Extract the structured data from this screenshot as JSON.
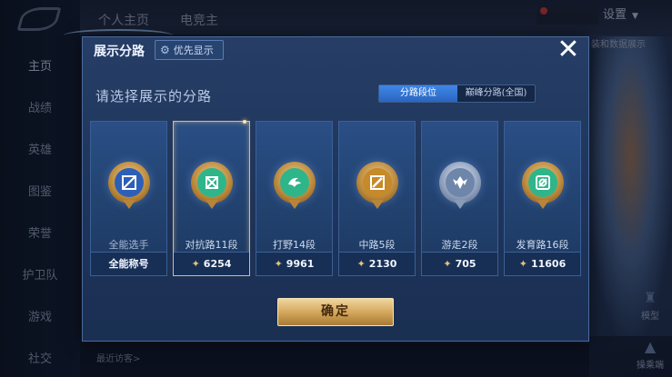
{
  "background": {
    "sidebar": [
      "主页",
      "战绩",
      "英雄",
      "图鉴",
      "荣誉",
      "护卫队",
      "游戏",
      "社交"
    ],
    "tabs": [
      "个人主页",
      "电竞主"
    ],
    "settings": "设置",
    "right_text": "装和数据展示",
    "right_buttons": [
      "模型",
      "操乘端"
    ],
    "recent": "最近访客>"
  },
  "dialog": {
    "title": "展示分路",
    "priority_label": "优先显示",
    "close_icon": "close-icon",
    "prompt": "请选择展示的分路",
    "segment": {
      "tabs": [
        "分路段位",
        "巅峰分路(全国)"
      ],
      "selected": 0
    },
    "cards": [
      {
        "label": "全能选手",
        "footer": "全能称号",
        "score": "",
        "icon": "all-rounder-emblem",
        "color": "#2d5fb8",
        "selected": false
      },
      {
        "label": "对抗路11段",
        "footer": "",
        "score": "6254",
        "icon": "clash-lane-emblem",
        "color": "#2fb58a",
        "selected": true
      },
      {
        "label": "打野14段",
        "footer": "",
        "score": "9961",
        "icon": "jungle-emblem",
        "color": "#2fb58a",
        "selected": false
      },
      {
        "label": "中路5段",
        "footer": "",
        "score": "2130",
        "icon": "mid-lane-emblem",
        "color": "#c58a2a",
        "selected": false
      },
      {
        "label": "游走2段",
        "footer": "",
        "score": "705",
        "icon": "roaming-emblem",
        "color": "#8fa6c8",
        "selected": false
      },
      {
        "label": "发育路16段",
        "footer": "",
        "score": "11606",
        "icon": "farm-lane-emblem",
        "color": "#2fb58a",
        "selected": false
      }
    ],
    "confirm": "确定"
  },
  "colors": {
    "accent_gold": "#d4a85e",
    "accent_blue": "#3f87e6",
    "panel": "#263e66"
  }
}
